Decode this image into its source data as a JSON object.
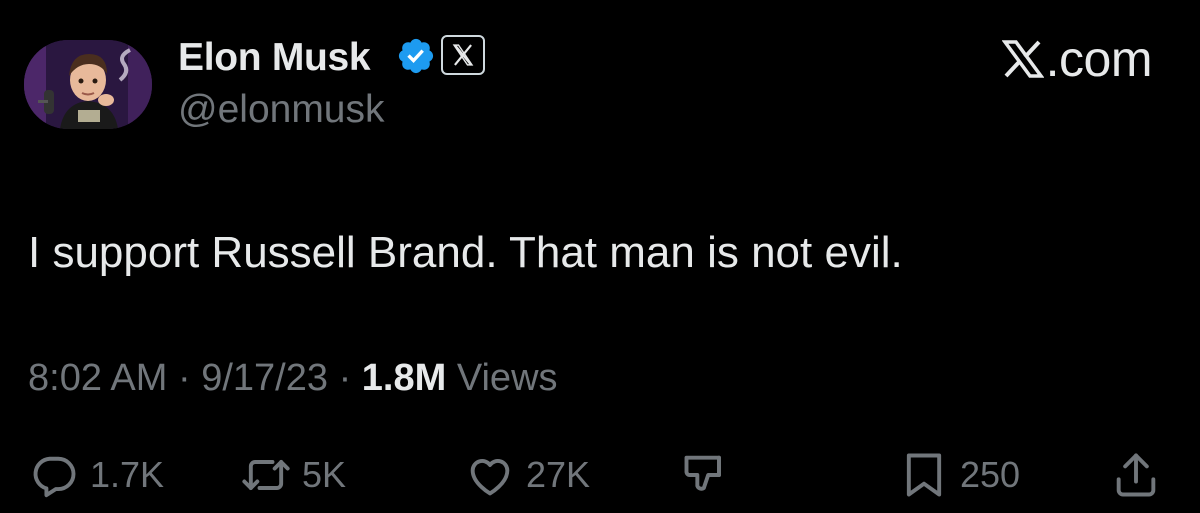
{
  "author": {
    "display_name": "Elon Musk",
    "handle": "@elonmusk",
    "verified": true,
    "verified_color": "#1d9bf0",
    "affiliate_badge_icon": "x-logo-icon"
  },
  "watermark": {
    "text": ".com",
    "icon": "x-logo-icon"
  },
  "tweet": {
    "text": "I support Russell Brand. That man is not evil.",
    "time": "8:02 AM",
    "date": "9/17/23",
    "separator": "·",
    "views_count": "1.8M",
    "views_label": "Views"
  },
  "actions": {
    "replies": "1.7K",
    "retweets": "5K",
    "likes": "27K",
    "bookmarks": "250"
  },
  "colors": {
    "background": "#000000",
    "text_primary": "#e7e9ea",
    "text_secondary": "#71767b",
    "accent": "#1d9bf0"
  }
}
